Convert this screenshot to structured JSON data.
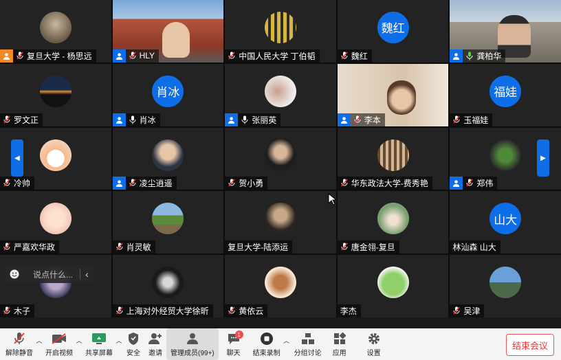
{
  "tiles": [
    {
      "name": "复旦大学 - 杨思远",
      "badge": "orange",
      "kind": "photo-avatar",
      "mic": "muted"
    },
    {
      "name": "HLY",
      "badge": "blue",
      "kind": "video",
      "mic": "muted"
    },
    {
      "name": "中国人民大学 丁伯韬",
      "badge": "",
      "kind": "photo-avatar",
      "mic": "muted"
    },
    {
      "name": "魏红",
      "badge": "",
      "kind": "text-avatar",
      "avatar_text": "魏红",
      "mic": "muted"
    },
    {
      "name": "龚柏华",
      "badge": "blue",
      "kind": "video",
      "mic": "on"
    },
    {
      "name": "罗文正",
      "badge": "",
      "kind": "photo-avatar",
      "mic": "muted"
    },
    {
      "name": "肖冰",
      "badge": "blue",
      "kind": "text-avatar",
      "avatar_text": "肖冰",
      "mic": "on"
    },
    {
      "name": "张丽英",
      "badge": "blue",
      "kind": "photo-avatar",
      "mic": "on"
    },
    {
      "name": "李本",
      "badge": "blue",
      "kind": "video",
      "mic": "muted"
    },
    {
      "name": "玉福娃",
      "badge": "",
      "kind": "text-avatar",
      "avatar_text": "福娃",
      "mic": "muted"
    },
    {
      "name": "冷帅",
      "badge": "",
      "kind": "photo-avatar",
      "mic": "muted"
    },
    {
      "name": "凌尘逍遥",
      "badge": "blue",
      "kind": "photo-avatar",
      "mic": "muted"
    },
    {
      "name": "贺小勇",
      "badge": "",
      "kind": "photo-avatar",
      "mic": "muted"
    },
    {
      "name": "华东政法大学-费秀艳",
      "badge": "",
      "kind": "photo-avatar",
      "mic": "muted"
    },
    {
      "name": "郑伟",
      "badge": "blue",
      "kind": "photo-avatar",
      "mic": "muted"
    },
    {
      "name": "严嘉欢华政",
      "badge": "",
      "kind": "photo-avatar",
      "mic": "muted"
    },
    {
      "name": "肖灵敏",
      "badge": "",
      "kind": "photo-avatar",
      "mic": "muted"
    },
    {
      "name": "复旦大学-陆添运",
      "badge": "",
      "kind": "photo-avatar",
      "mic": "none"
    },
    {
      "name": "唐金翎-复旦",
      "badge": "",
      "kind": "photo-avatar",
      "mic": "muted"
    },
    {
      "name": "林汕森 山大",
      "badge": "",
      "kind": "text-avatar",
      "avatar_text": "山大",
      "mic": "none"
    },
    {
      "name": "木子",
      "badge": "",
      "kind": "photo-avatar",
      "mic": "muted"
    },
    {
      "name": "上海对外经贸大学徐昕",
      "badge": "",
      "kind": "photo-avatar",
      "mic": "muted"
    },
    {
      "name": "黄依云",
      "badge": "",
      "kind": "photo-avatar",
      "mic": "muted"
    },
    {
      "name": "李杰",
      "badge": "",
      "kind": "photo-avatar",
      "mic": "none"
    },
    {
      "name": "吴津",
      "badge": "",
      "kind": "photo-avatar",
      "mic": "muted"
    }
  ],
  "chat": {
    "placeholder": "说点什么..."
  },
  "toolbar": {
    "unmute": "解除静音",
    "start_video": "开启视频",
    "share_screen": "共享屏幕",
    "security": "安全",
    "invite": "邀请",
    "manage_members": "管理成员(99+)",
    "chat": "聊天",
    "chat_badge": "1",
    "end_recording": "结束录制",
    "breakout": "分组讨论",
    "apps": "应用",
    "settings": "设置",
    "end_meeting": "结束会议"
  },
  "colors": {
    "accent": "#0e6ee8",
    "host_orange": "#f08a24",
    "danger": "#e33333"
  }
}
